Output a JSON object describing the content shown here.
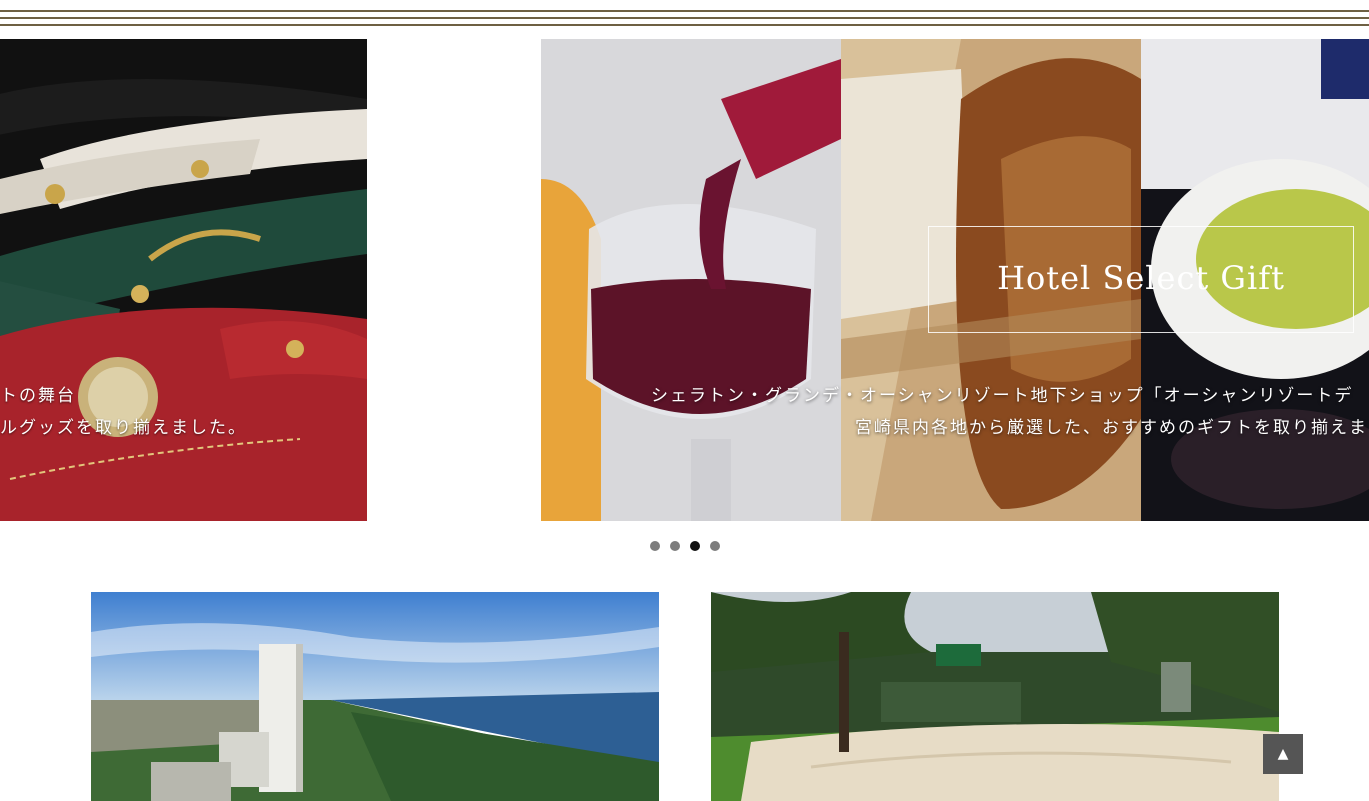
{
  "carousel": {
    "left_slide": {
      "caption_line1": "トの舞台",
      "caption_line2": "ルグッズを取り揃えました。"
    },
    "main_slide": {
      "title": "Hotel Select Gift",
      "caption_line1": "シェラトン・グランデ・オーシャンリゾート地下ショップ「オーシャンリゾートデ",
      "caption_line2": "宮崎県内各地から厳選した、おすすめのギフトを取り揃えま"
    },
    "dots_count": 4,
    "active_dot": 3
  },
  "back_to_top": {
    "label": "▲"
  }
}
